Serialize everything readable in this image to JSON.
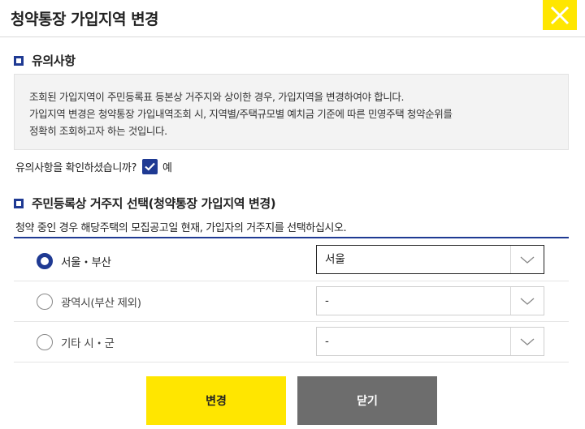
{
  "dialog": {
    "title": "청약통장 가입지역 변경"
  },
  "notice": {
    "heading": "유의사항",
    "lines": [
      "조회된 가입지역이 주민등록표 등본상 거주지와 상이한 경우, 가입지역을 변경하여야 합니다.",
      "가입지역 변경은 청약통장 가입내역조회 시, 지역별/주택규모별 예치금 기준에 따른 민영주택 청약순위를",
      "정확히 조회하고자 하는 것입니다."
    ]
  },
  "confirm": {
    "question": "유의사항을 확인하셨습니까?",
    "answer": "예",
    "checked": true
  },
  "residence": {
    "heading": "주민등록상 거주지 선택(청약통장 가입지역 변경)",
    "description": "청약 중인 경우 해당주택의 모집공고일 현재, 가입자의 거주지를 선택하십시오.",
    "options": [
      {
        "label": "서울・부산",
        "selected": true,
        "select_value": "서울"
      },
      {
        "label": "광역시(부산 제외)",
        "selected": false,
        "select_value": "-"
      },
      {
        "label": "기타 시・군",
        "selected": false,
        "select_value": "-"
      }
    ]
  },
  "buttons": {
    "change": "변경",
    "close": "닫기"
  },
  "colors": {
    "accent_yellow": "#ffe600",
    "navy": "#1f3a93",
    "close_gray": "#6d6d6d"
  }
}
